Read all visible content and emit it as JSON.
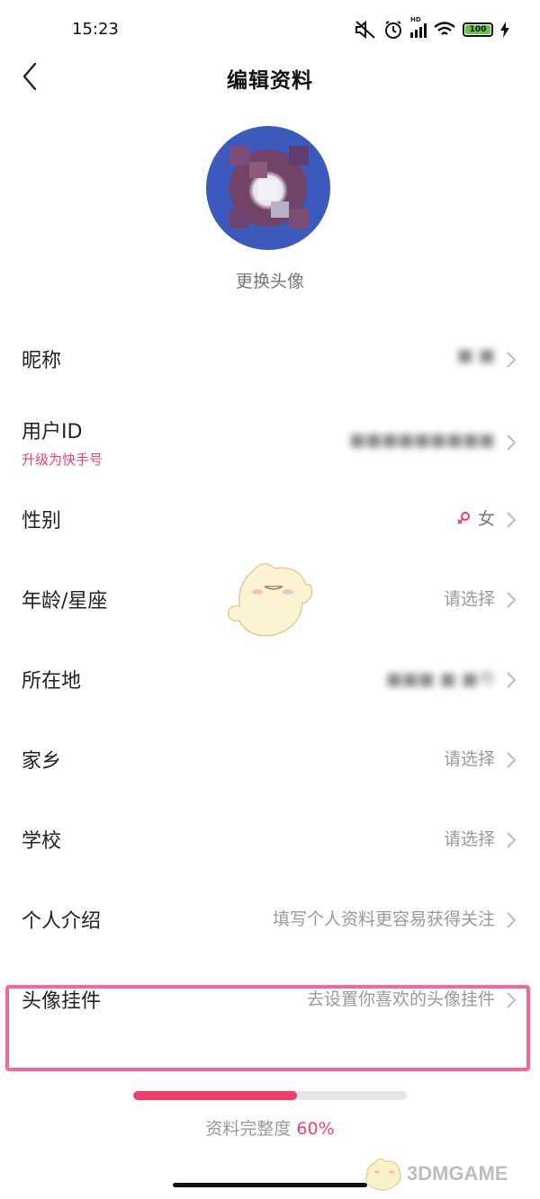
{
  "status_bar": {
    "time": "15:23",
    "battery": "100",
    "icons": [
      "mute-icon",
      "alarm-icon",
      "signal-icon",
      "wifi-icon",
      "battery-icon",
      "charging-icon"
    ],
    "signal_tag": "HD"
  },
  "header": {
    "title": "编辑资料",
    "back_icon": "chevron-left-icon"
  },
  "avatar": {
    "change_label": "更换头像"
  },
  "rows": [
    {
      "label": "昵称",
      "value": "■ ■"
    },
    {
      "label": "用户ID",
      "sub": "升级为快手号",
      "value": "■■■■■■■■■"
    },
    {
      "label": "性别",
      "value": "女",
      "value_icon": "female-icon"
    },
    {
      "label": "年龄/星座",
      "value": "请选择"
    },
    {
      "label": "所在地",
      "value": "■■■ ■ ■市"
    },
    {
      "label": "家乡",
      "value": "请选择"
    },
    {
      "label": "学校",
      "value": "请选择"
    },
    {
      "label": "个人介绍",
      "value": "填写个人资料更容易获得关注"
    },
    {
      "label": "头像挂件",
      "value": "去设置你喜欢的头像挂件"
    }
  ],
  "profile_completeness": {
    "label": "资料完整度",
    "percent_text": "60%",
    "fraction": 0.6
  },
  "colors": {
    "accent": "#ee3d6b",
    "highlight": "#f06a93",
    "muted": "#9a9a9a"
  },
  "watermark": {
    "text": "3DMGAME"
  }
}
